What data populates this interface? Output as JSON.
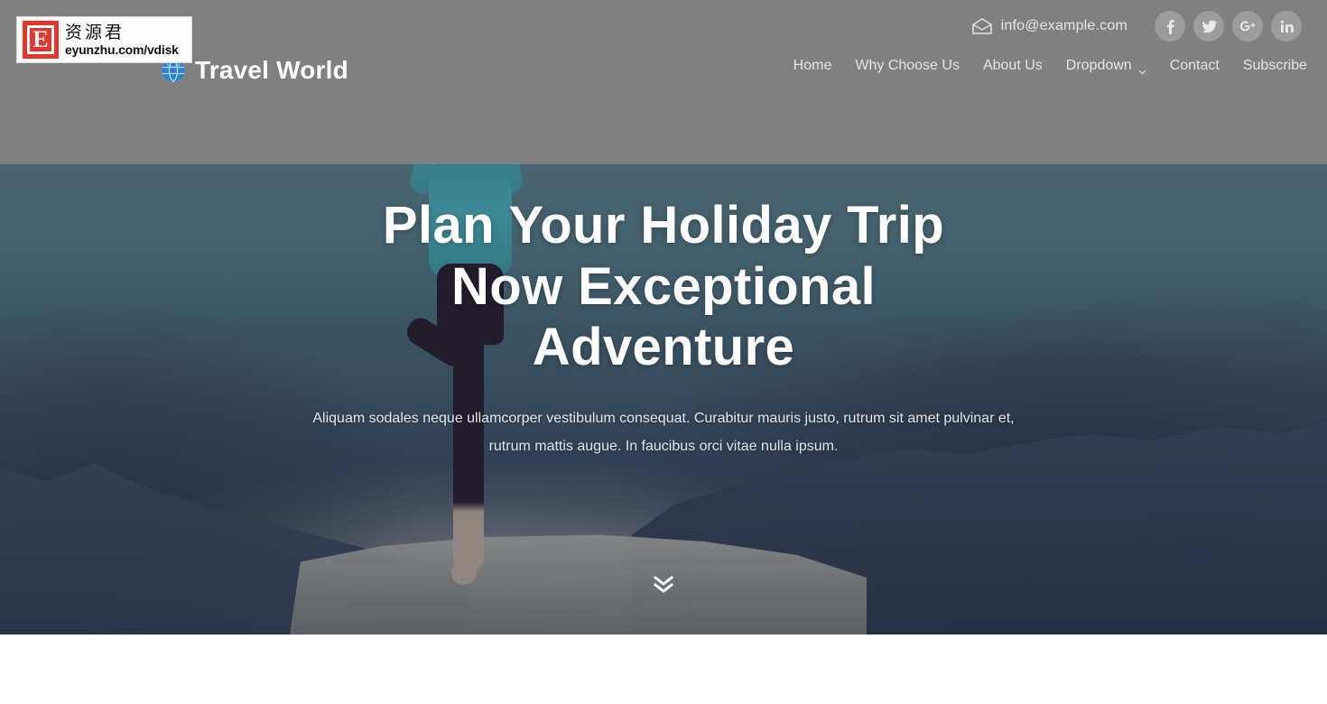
{
  "site": {
    "brand_name": "Travel World",
    "brand_icon": "globe-icon"
  },
  "topbar": {
    "email_icon": "envelope-open-icon",
    "email": "info@example.com",
    "socials": [
      {
        "name": "facebook",
        "label": "f"
      },
      {
        "name": "twitter",
        "label": "t"
      },
      {
        "name": "google-plus",
        "label": "G+"
      },
      {
        "name": "linkedin",
        "label": "in"
      }
    ]
  },
  "nav": {
    "items": [
      {
        "label": "Home",
        "has_caret": false
      },
      {
        "label": "Why Choose Us",
        "has_caret": false
      },
      {
        "label": "About Us",
        "has_caret": false
      },
      {
        "label": "Dropdown",
        "has_caret": true
      },
      {
        "label": "Contact",
        "has_caret": false
      },
      {
        "label": "Subscribe",
        "has_caret": false
      }
    ]
  },
  "hero": {
    "title": "Plan Your Holiday Trip Now Exceptional Adventure",
    "subtitle": "Aliquam sodales neque ullamcorper vestibulum consequat. Curabitur mauris justo, rutrum sit amet pulvinar et, rutrum mattis augue. In faucibus orci vitae nulla ipsum.",
    "scroll_icon": "chevron-double-down-icon"
  },
  "watermark": {
    "badge_letter": "E",
    "chinese": "资源君",
    "url": "eyunzhu.com/vdisk"
  },
  "colors": {
    "brand_text": "#ffffff",
    "nav_text": "#e4e4e4",
    "hero_title": "#ffffff",
    "watermark_red": "#e8342a",
    "top_band": "#808080"
  }
}
